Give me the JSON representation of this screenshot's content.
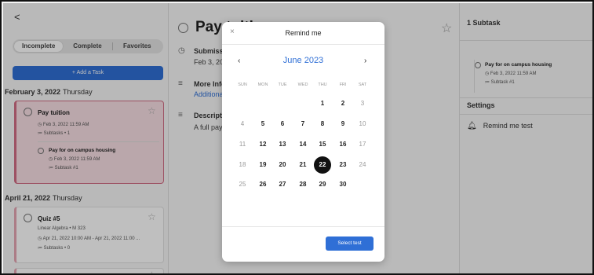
{
  "left": {
    "back": "<",
    "tabs": [
      "Incomplete",
      "Complete",
      "Favorites"
    ],
    "add_task": "+ Add a Task",
    "groups": [
      {
        "date": "February 3, 2022",
        "weekday": "Thursday"
      },
      {
        "date": "April 21, 2022",
        "weekday": "Thursday"
      }
    ],
    "task1": {
      "title": "Pay tuition",
      "datetime": "Feb 3, 2022 11:59 AM",
      "subtasks": "Subtasks • 1",
      "sub_title": "Pay for on campus housing",
      "sub_datetime": "Feb 3, 2022 11:59 AM",
      "sub_subtasks": "Subtask #1"
    },
    "task2": {
      "title": "Quiz #5",
      "course": "Linear Algebra • M 323",
      "datetime": "Apr 21, 2022 10:00 AM - Apr 21, 2022 11:00 ...",
      "subtasks": "Subtasks • 0"
    }
  },
  "middle": {
    "title": "Pay tuition",
    "submission_label": "Submission",
    "submission_value": "Feb 3, 2022",
    "more_info_label": "More Info",
    "more_info_link": "Additional",
    "description_label": "Description",
    "description_value": "A full pay"
  },
  "right": {
    "subtask_count": "1 Subtask",
    "sub_title": "Pay for on campus housing",
    "sub_datetime": "Feb 3, 2022 11:59 AM",
    "sub_subtasks": "Subtask #1",
    "settings_label": "Settings",
    "reminder": "Remind me test"
  },
  "modal": {
    "close": "×",
    "title": "Remind me",
    "prev": "‹",
    "next": "›",
    "month": "June 2023",
    "weekdays": [
      "SUN",
      "MON",
      "TUE",
      "WED",
      "THU",
      "FRI",
      "SAT"
    ],
    "selected_day": 22,
    "select_button": "Select test"
  },
  "colors": {
    "accent": "#2f6fd6",
    "selected_task": "#f8dfe4",
    "task_border": "#d26d84"
  }
}
